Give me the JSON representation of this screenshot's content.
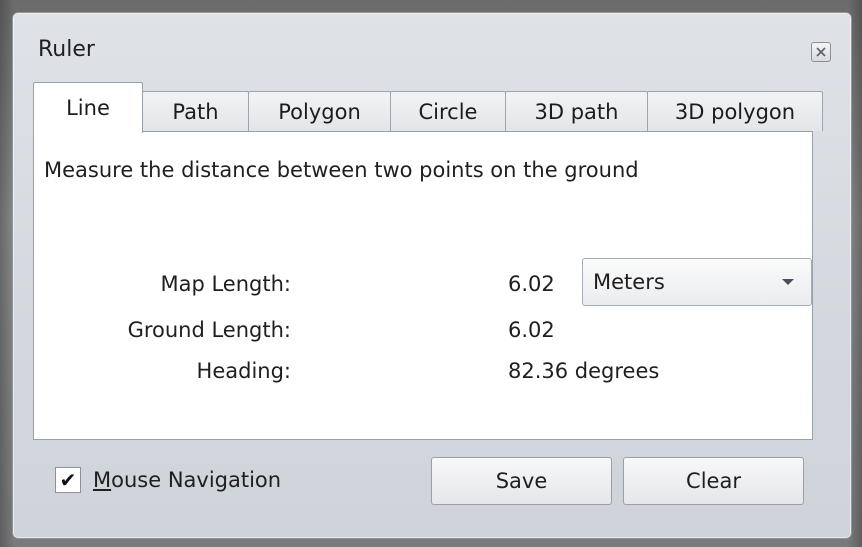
{
  "window": {
    "title": "Ruler"
  },
  "tabs": [
    {
      "label": "Line",
      "active": true
    },
    {
      "label": "Path",
      "active": false
    },
    {
      "label": "Polygon",
      "active": false
    },
    {
      "label": "Circle",
      "active": false
    },
    {
      "label": "3D path",
      "active": false
    },
    {
      "label": "3D polygon",
      "active": false
    }
  ],
  "panel": {
    "description": "Measure the distance between two points on the ground",
    "map_length": {
      "label": "Map Length:",
      "value": "6.02"
    },
    "unit_select": {
      "selected": "Meters"
    },
    "ground_length": {
      "label": "Ground Length:",
      "value": "6.02"
    },
    "heading": {
      "label": "Heading:",
      "value": "82.36 degrees"
    }
  },
  "footer": {
    "mouse_navigation": {
      "label": "Mouse Navigation",
      "checked": true,
      "check_glyph": "✔"
    },
    "save_label": "Save",
    "clear_label": "Clear"
  },
  "icons": {
    "close": "close-icon",
    "dropdown": "chevron-down-icon",
    "check": "checkmark-icon"
  }
}
